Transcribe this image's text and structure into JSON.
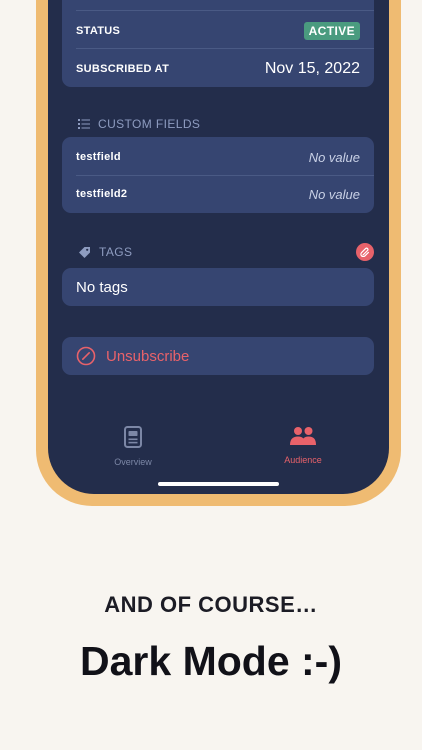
{
  "subscriber": {
    "status_label": "STATUS",
    "status_value": "ACTIVE",
    "subscribed_label": "SUBSCRIBED AT",
    "subscribed_value": "Nov 15, 2022"
  },
  "custom_fields": {
    "header": "CUSTOM FIELDS",
    "fields": [
      {
        "name": "testfield",
        "value": "No value"
      },
      {
        "name": "testfield2",
        "value": "No value"
      }
    ]
  },
  "tags": {
    "header": "TAGS",
    "empty_text": "No tags"
  },
  "unsubscribe": {
    "label": "Unsubscribe"
  },
  "tabbar": {
    "tabs": [
      {
        "label": "Overview",
        "icon": "document-icon",
        "active": false
      },
      {
        "label": "Audience",
        "icon": "people-icon",
        "active": true
      }
    ]
  },
  "colors": {
    "accent": "#e8626a",
    "active_badge": "#4a9b7f",
    "card": "#364571",
    "screen": "#232d4b",
    "frame": "#efbb72"
  },
  "caption": {
    "line1": "AND OF COURSE…",
    "line2": "Dark Mode :-)"
  }
}
